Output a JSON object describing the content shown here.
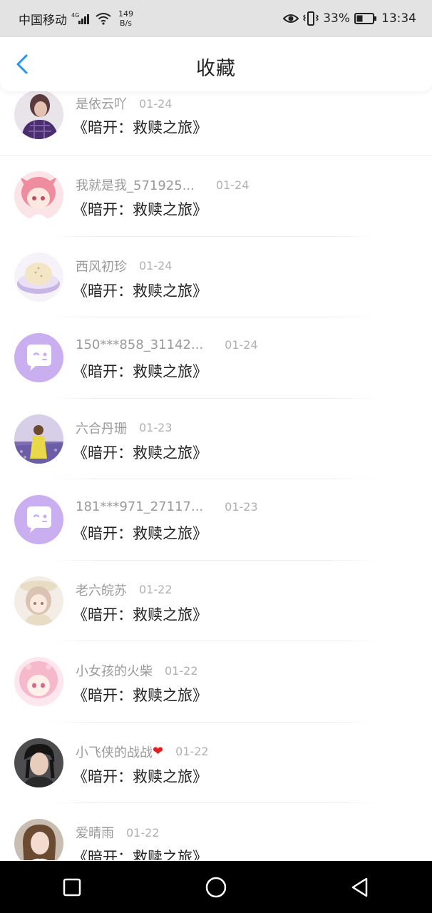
{
  "status_bar": {
    "carrier": "中国移动",
    "network": "4G",
    "speed_value": "149",
    "speed_unit": "B/s",
    "battery": "33%",
    "time": "13:34"
  },
  "header": {
    "title": "收藏"
  },
  "items": [
    {
      "name": "是依云吖",
      "date": "01-24",
      "work": "《暗开：救赎之旅》",
      "avatar": "photo-purple-shirt"
    },
    {
      "name": "我就是我_571925...",
      "date": "01-24",
      "work": "《暗开：救赎之旅》",
      "avatar": "anime-pink-girl"
    },
    {
      "name": "西风初珍",
      "date": "01-24",
      "work": "《暗开：救赎之旅》",
      "avatar": "food-bowl"
    },
    {
      "name": "150***858_31142...",
      "date": "01-24",
      "work": "《暗开：救赎之旅》",
      "avatar": "default-chat-face"
    },
    {
      "name": "六合丹珊",
      "date": "01-23",
      "work": "《暗开：救赎之旅》",
      "avatar": "photo-lavender-field"
    },
    {
      "name": "181***971_27117...",
      "date": "01-23",
      "work": "《暗开：救赎之旅》",
      "avatar": "default-chat-face"
    },
    {
      "name": "老六皖苏",
      "date": "01-22",
      "work": "《暗开：救赎之旅》",
      "avatar": "anime-hat-girl"
    },
    {
      "name": "小女孩的火柴",
      "date": "01-22",
      "work": "《暗开：救赎之旅》",
      "avatar": "anime-pink-hair"
    },
    {
      "name": "小飞侠的战战",
      "name_suffix": "❤",
      "date": "01-22",
      "work": "《暗开：救赎之旅》",
      "avatar": "photo-man-dark-hair"
    },
    {
      "name": "爱晴雨",
      "date": "01-22",
      "work": "《暗开：救赎之旅》",
      "avatar": "photo-woman-portrait"
    }
  ],
  "colors": {
    "accent": "#2196f3",
    "default_avatar_bg": "#c9aef0"
  }
}
